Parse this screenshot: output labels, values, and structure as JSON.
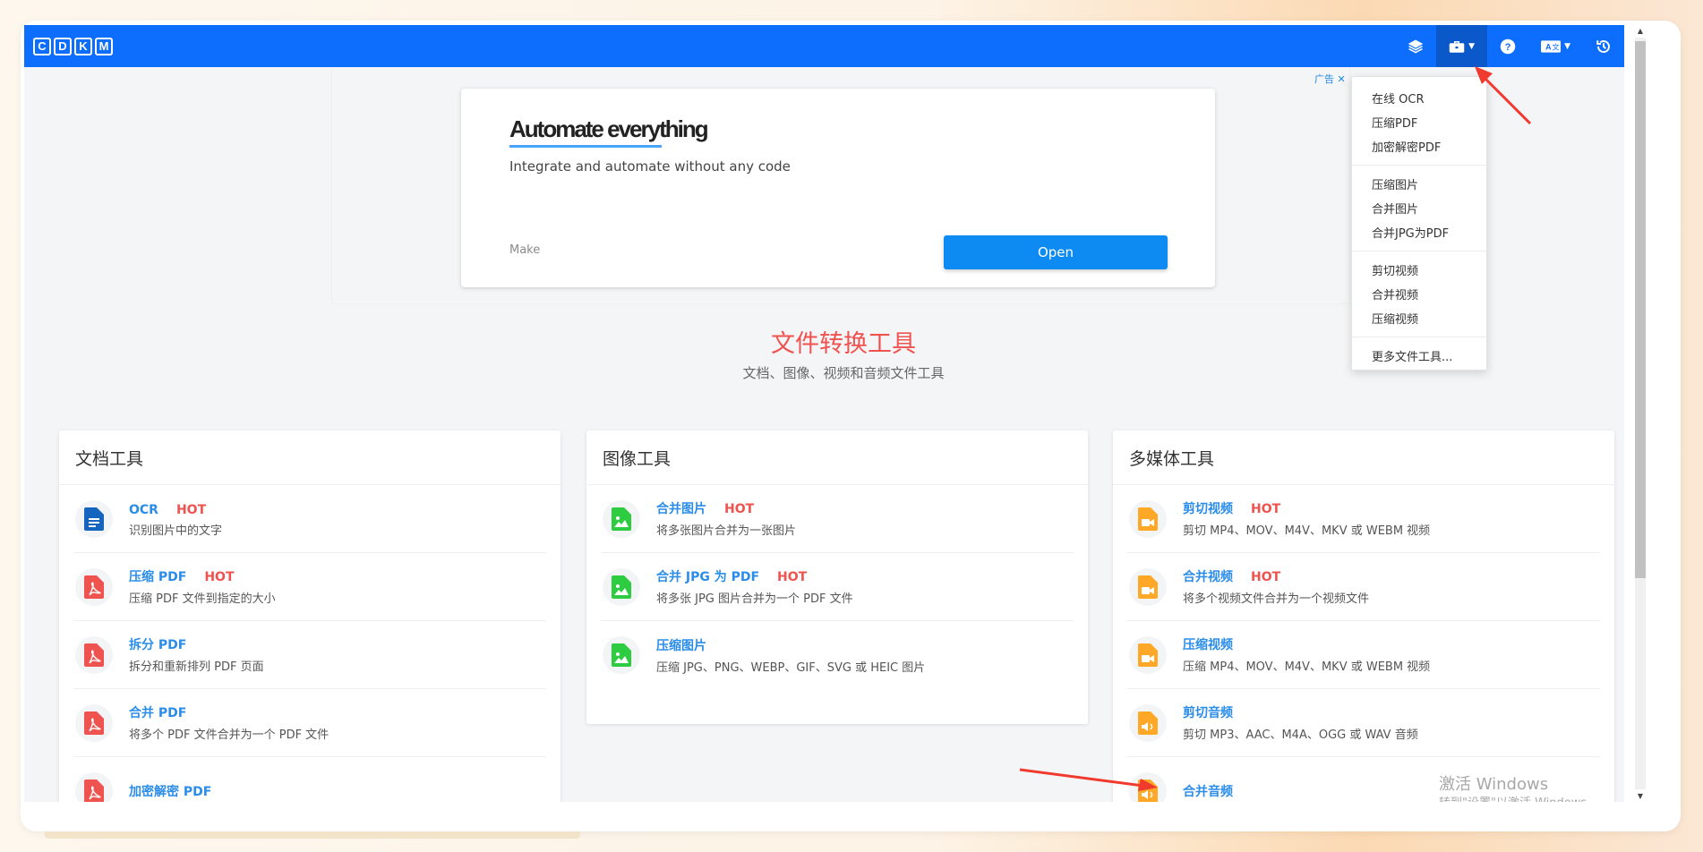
{
  "logo": [
    "C",
    "D",
    "K",
    "M"
  ],
  "topbar": {
    "actions": [
      {
        "icon": "layers-icon"
      },
      {
        "icon": "toolbox-icon",
        "active": true
      },
      {
        "icon": "help-icon"
      },
      {
        "icon": "language-icon"
      },
      {
        "icon": "history-icon"
      }
    ]
  },
  "ad": {
    "tag": "广告 ✕",
    "title": "Automate everything",
    "subtitle": "Integrate and automate without any code",
    "brand": "Make",
    "button": "Open"
  },
  "hero": {
    "title": "文件转换工具",
    "subtitle": "文档、图像、视频和音频文件工具"
  },
  "panels": [
    {
      "title": "文档工具",
      "tools": [
        {
          "name": "OCR",
          "hot": "HOT",
          "desc": "识别图片中的文字",
          "icon": "doc"
        },
        {
          "name": "压缩 PDF",
          "hot": "HOT",
          "desc": "压缩 PDF 文件到指定的大小",
          "icon": "pdf"
        },
        {
          "name": "拆分 PDF",
          "hot": "",
          "desc": "拆分和重新排列 PDF 页面",
          "icon": "pdf"
        },
        {
          "name": "合并 PDF",
          "hot": "",
          "desc": "将多个 PDF 文件合并为一个 PDF 文件",
          "icon": "pdf"
        },
        {
          "name": "加密解密 PDF",
          "hot": "",
          "desc": "",
          "icon": "pdf"
        }
      ]
    },
    {
      "title": "图像工具",
      "tools": [
        {
          "name": "合并图片",
          "hot": "HOT",
          "desc": "将多张图片合并为一张图片",
          "icon": "img"
        },
        {
          "name": "合并 JPG 为 PDF",
          "hot": "HOT",
          "desc": "将多张 JPG 图片合并为一个 PDF 文件",
          "icon": "img"
        },
        {
          "name": "压缩图片",
          "hot": "",
          "desc": "压缩 JPG、PNG、WEBP、GIF、SVG 或 HEIC 图片",
          "icon": "img"
        }
      ]
    },
    {
      "title": "多媒体工具",
      "tools": [
        {
          "name": "剪切视频",
          "hot": "HOT",
          "desc": "剪切 MP4、MOV、M4V、MKV 或 WEBM 视频",
          "icon": "video"
        },
        {
          "name": "合并视频",
          "hot": "HOT",
          "desc": "将多个视频文件合并为一个视频文件",
          "icon": "video"
        },
        {
          "name": "压缩视频",
          "hot": "",
          "desc": "压缩 MP4、MOV、M4V、MKV 或 WEBM 视频",
          "icon": "video"
        },
        {
          "name": "剪切音频",
          "hot": "",
          "desc": "剪切 MP3、AAC、M4A、OGG 或 WAV 音频",
          "icon": "audio"
        },
        {
          "name": "合并音频",
          "hot": "",
          "desc": "",
          "icon": "audio"
        }
      ]
    }
  ],
  "dropdown": {
    "groups": [
      [
        "在线 OCR",
        "压缩PDF",
        "加密解密PDF"
      ],
      [
        "压缩图片",
        "合并图片",
        "合并JPG为PDF"
      ],
      [
        "剪切视频",
        "合并视频",
        "压缩视频"
      ],
      [
        "更多文件工具..."
      ]
    ]
  },
  "watermark": {
    "line1": "激活 Windows",
    "line2": "转到\"设置\"以激活 Windows。"
  },
  "colors": {
    "topbar": "#0d6efd",
    "link": "#2b8de8",
    "hot": "#ef5350",
    "pdf": "#ef5350",
    "doc": "#1565c0",
    "img": "#2ecc40",
    "media": "#ffa726",
    "annotation_arrow": "#f03a2e"
  }
}
